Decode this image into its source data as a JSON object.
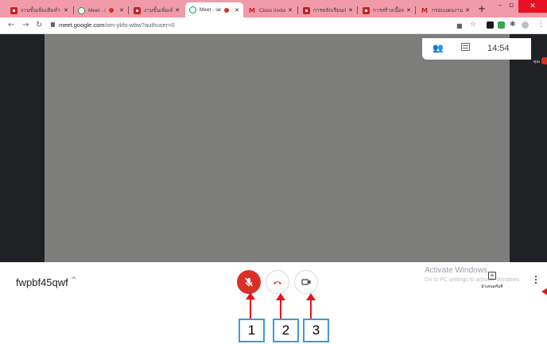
{
  "browser": {
    "tabs": [
      {
        "title": "งานขั้นเพิ่มเติมทำ",
        "favicon": "slides-icon",
        "recording": false,
        "active": false
      },
      {
        "title": "Meet - iam",
        "favicon": "meet-icon",
        "recording": true,
        "active": false
      },
      {
        "title": "งานขั้นเพิ่มเติมทำ",
        "favicon": "slides-icon",
        "recording": false,
        "active": false
      },
      {
        "title": "Meet - iam",
        "favicon": "meet-icon",
        "recording": true,
        "active": true
      },
      {
        "title": "Class invitation",
        "favicon": "gmail-icon",
        "recording": false,
        "active": false
      },
      {
        "title": "การหลักเรียนเพิ่มเติม",
        "favicon": "slides-icon",
        "recording": false,
        "active": false
      },
      {
        "title": "การสร้างเนื้อหาใหม่",
        "favicon": "slides-icon",
        "recording": false,
        "active": false
      },
      {
        "title": "กรอบแผนงาน (ไ",
        "favicon": "gmail-icon",
        "recording": false,
        "active": false
      }
    ],
    "new_tab": "+",
    "url_host": "meet.google.com",
    "url_path": "/om-ykfo-wbw?authuser=0",
    "colors": {
      "tabstrip": "#f29ba8",
      "close": "#e81123"
    }
  },
  "meeting": {
    "clock": "14:54",
    "self_label": "คุณ",
    "code": "fwpbf45qwf",
    "code_caret": "^",
    "controls": [
      {
        "name": "microphone-off",
        "state": "muted"
      },
      {
        "name": "leave-call"
      },
      {
        "name": "camera"
      }
    ],
    "present_label": "นำเสนอทันที",
    "activate_title": "Activate Windows",
    "activate_sub": "Go to PC settings to activate Windows."
  },
  "annotations": {
    "labels": [
      "1",
      "2",
      "3"
    ],
    "color": "#e3151a",
    "box_color": "#3d9bd8"
  }
}
